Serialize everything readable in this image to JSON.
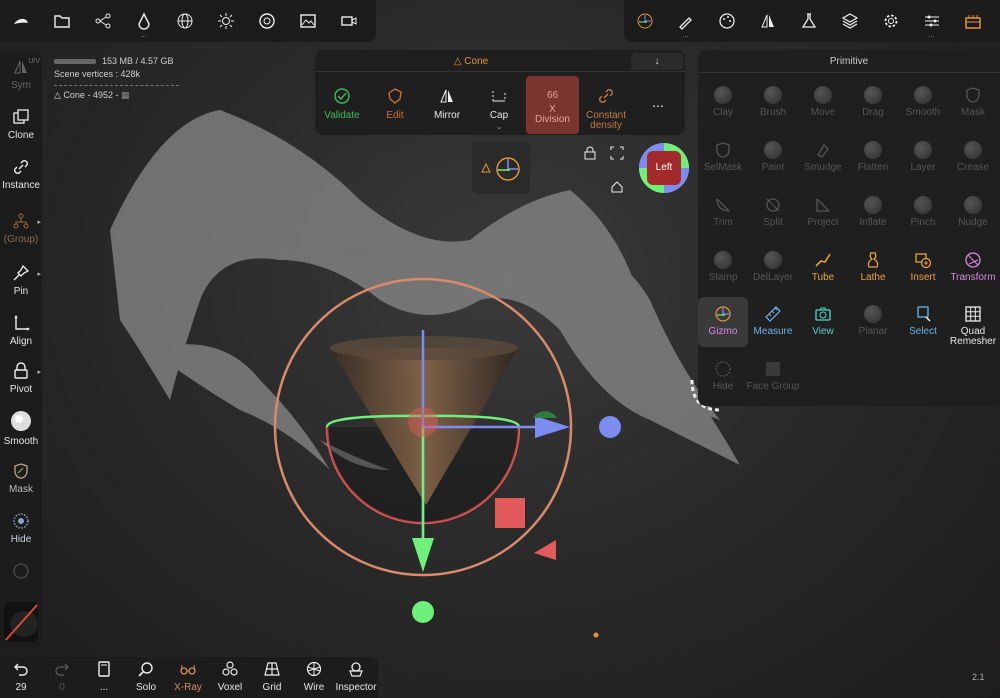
{
  "top_toolbar_left": [
    {
      "name": "nomad-logo-icon"
    },
    {
      "name": "folder-icon"
    },
    {
      "name": "scene-graph-icon"
    },
    {
      "name": "material-drop-icon",
      "dots": "..."
    },
    {
      "name": "wireframe-sphere-icon"
    },
    {
      "name": "light-icon"
    },
    {
      "name": "camera-lens-icon"
    },
    {
      "name": "image-icon"
    },
    {
      "name": "video-camera-icon"
    }
  ],
  "top_toolbar_right": [
    {
      "name": "gizmo-tool-icon"
    },
    {
      "name": "brush-tool-icon",
      "dots": "..."
    },
    {
      "name": "palette-icon"
    },
    {
      "name": "symmetry-icon"
    },
    {
      "name": "flask-icon"
    },
    {
      "name": "layers-icon"
    },
    {
      "name": "settings-gear-icon"
    },
    {
      "name": "sliders-icon",
      "dots": "..."
    },
    {
      "name": "interface-icon"
    }
  ],
  "left_sidebar": {
    "items": [
      {
        "label": "Sym",
        "uv": "U/V",
        "dim": true
      },
      {
        "label": "Clone",
        "dim": false
      },
      {
        "label": "Instance",
        "dim": false
      },
      {
        "label": "(Group)",
        "dim": true
      },
      {
        "label": "Pin",
        "dim": false
      },
      {
        "label": "Align",
        "dim": false
      },
      {
        "label": "Pivot",
        "dim": false
      },
      {
        "label": "Smooth",
        "dim": false
      },
      {
        "label": "Mask",
        "dim": false
      },
      {
        "label": "Hide",
        "dim": false
      }
    ]
  },
  "bottom_bar": {
    "items": [
      {
        "label": "29",
        "name": "undo"
      },
      {
        "label": "0",
        "name": "redo"
      },
      {
        "label": "...",
        "name": "history"
      },
      {
        "label": "Solo",
        "name": "solo"
      },
      {
        "label": "X-Ray",
        "name": "xray",
        "active": true
      },
      {
        "label": "Voxel",
        "name": "voxel"
      },
      {
        "label": "Grid",
        "name": "grid"
      },
      {
        "label": "Wire",
        "name": "wire"
      },
      {
        "label": "Inspector",
        "name": "inspector"
      }
    ]
  },
  "info": {
    "memory": "153 MB / 4.57 GB",
    "vertices": "Scene vertices : 428k",
    "object": "Cone - 4952 -"
  },
  "cone_panel": {
    "title": "Cone",
    "collapse": "↓",
    "items": [
      {
        "label": "Validate",
        "color": "#3cbe5a"
      },
      {
        "label": "Edit",
        "color": "#d9703a"
      },
      {
        "label": "Mirror",
        "color": "#e6e6e6"
      },
      {
        "label": "Cap",
        "color": "#e6e6e6"
      },
      {
        "label": "X\nDivision",
        "value": "66",
        "color": "#e8a19b"
      },
      {
        "label": "Constant\ndensity",
        "color": "#c37a45"
      },
      {
        "label": "...",
        "color": "#e6e6e6"
      }
    ]
  },
  "primitive_panel": {
    "title": "Primitive",
    "items": [
      {
        "label": "Clay",
        "dim": true
      },
      {
        "label": "Brush",
        "dim": true
      },
      {
        "label": "Move",
        "dim": true
      },
      {
        "label": "Drag",
        "dim": true
      },
      {
        "label": "Smooth",
        "dim": true
      },
      {
        "label": "Mask",
        "dim": true
      },
      {
        "label": "SelMask",
        "dim": true
      },
      {
        "label": "Paint",
        "dim": true
      },
      {
        "label": "Smudge",
        "dim": true
      },
      {
        "label": "Flatten",
        "dim": true
      },
      {
        "label": "Layer",
        "dim": true
      },
      {
        "label": "Crease",
        "dim": true
      },
      {
        "label": "Trim",
        "dim": true
      },
      {
        "label": "Split",
        "dim": true
      },
      {
        "label": "Project",
        "dim": true
      },
      {
        "label": "Inflate",
        "dim": true
      },
      {
        "label": "Pinch",
        "dim": true
      },
      {
        "label": "Nudge",
        "dim": true
      },
      {
        "label": "Stamp",
        "dim": true
      },
      {
        "label": "DelLayer",
        "dim": true
      },
      {
        "label": "Tube",
        "color": "#e8a23c"
      },
      {
        "label": "Lathe",
        "color": "#e8a23c"
      },
      {
        "label": "Insert",
        "color": "#e8a23c"
      },
      {
        "label": "Transform",
        "color": "#d98ae0"
      },
      {
        "label": "Gizmo",
        "color": "#d98ae0",
        "selected": true
      },
      {
        "label": "Measure",
        "color": "#6fb3ea"
      },
      {
        "label": "View",
        "color": "#4fd7c3"
      },
      {
        "label": "Planar",
        "dim": true
      },
      {
        "label": "Select",
        "color": "#6fb3ea"
      },
      {
        "label": "Quad\nRemesher",
        "color": "#e6e6e6"
      },
      {
        "label": "Hide",
        "dim": true
      },
      {
        "label": "Face Group",
        "dim": true
      }
    ]
  },
  "viewcube": {
    "label": "Left"
  },
  "version": "2.1",
  "colors": {
    "accent_orange": "#e3953d",
    "gizmo_red": "#e35a5a",
    "gizmo_green": "#6ef07a",
    "gizmo_blue": "#7d8cf0",
    "ring": "#d98a6a"
  }
}
